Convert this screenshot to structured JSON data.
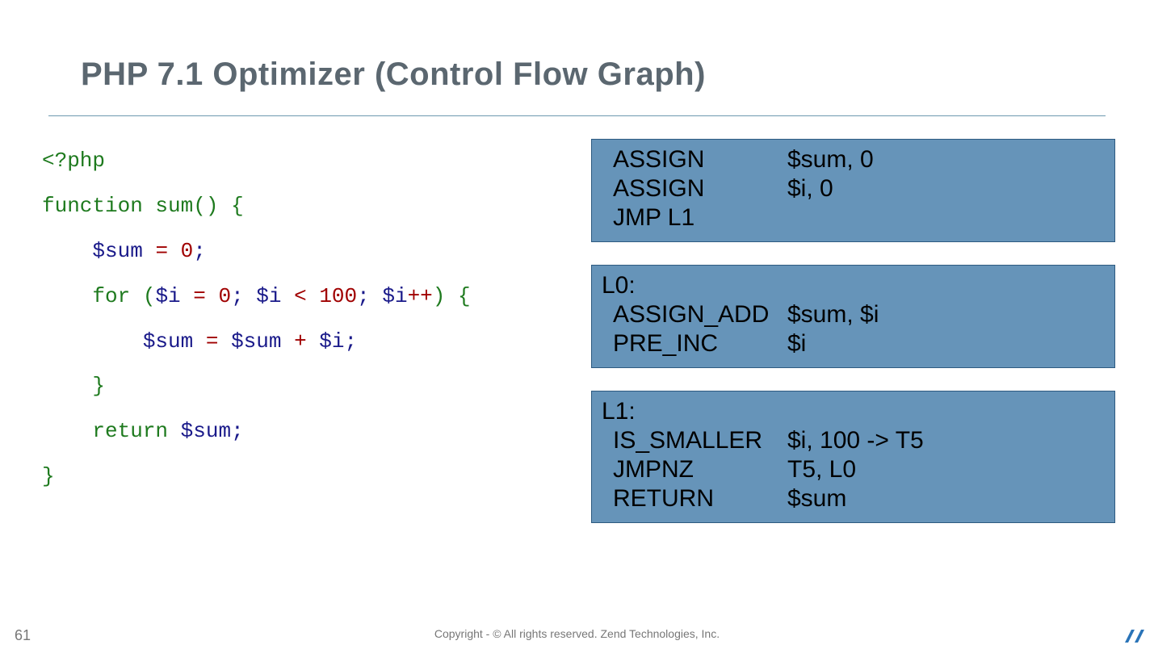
{
  "title": "PHP 7.1 Optimizer (Control Flow Graph)",
  "code": {
    "l1_open": "<?php",
    "l2_fn": "function",
    "l2_name": " sum",
    "l2_paren": "()",
    "l2_brace": " {",
    "l3_var": "$sum",
    "l3_eq": " = ",
    "l3_zero": "0",
    "l3_semi": ";",
    "l4_for": "for",
    "l4_po": " (",
    "l4_i": "$i",
    "l4_eq": " = ",
    "l4_z": "0",
    "l4_semi1": ";",
    "l4_i2": " $i",
    "l4_lt": " < ",
    "l4_h": "100",
    "l4_semi2": ";",
    "l4_i3": " $i",
    "l4_pp": "++",
    "l4_pc": ")",
    "l4_brace": " {",
    "l5_sum": "$sum",
    "l5_eq": " = ",
    "l5_sum2": "$sum",
    "l5_plus": " + ",
    "l5_i": "$i",
    "l5_semi": ";",
    "l6_close": "}",
    "l7_ret": "return",
    "l7_sum": " $sum",
    "l7_semi": ";",
    "l8_close": "}"
  },
  "box1": {
    "r1op": "ASSIGN",
    "r1arg": "$sum, 0",
    "r2op": "ASSIGN",
    "r2arg": "$i, 0",
    "r3op": "JMP L1"
  },
  "box2": {
    "label": "L0:",
    "r1op": "ASSIGN_ADD",
    "r1arg": "$sum, $i",
    "r2op": "PRE_INC",
    "r2arg": "$i"
  },
  "box3": {
    "label": "L1:",
    "r1op": "IS_SMALLER",
    "r1arg": "$i, 100 -> T5",
    "r2op": "JMPNZ",
    "r2arg": "T5, L0",
    "r3op": "RETURN",
    "r3arg": "$sum"
  },
  "footer": {
    "page": "61",
    "copyright": "Copyright - © All rights reserved. Zend Technologies, Inc."
  }
}
